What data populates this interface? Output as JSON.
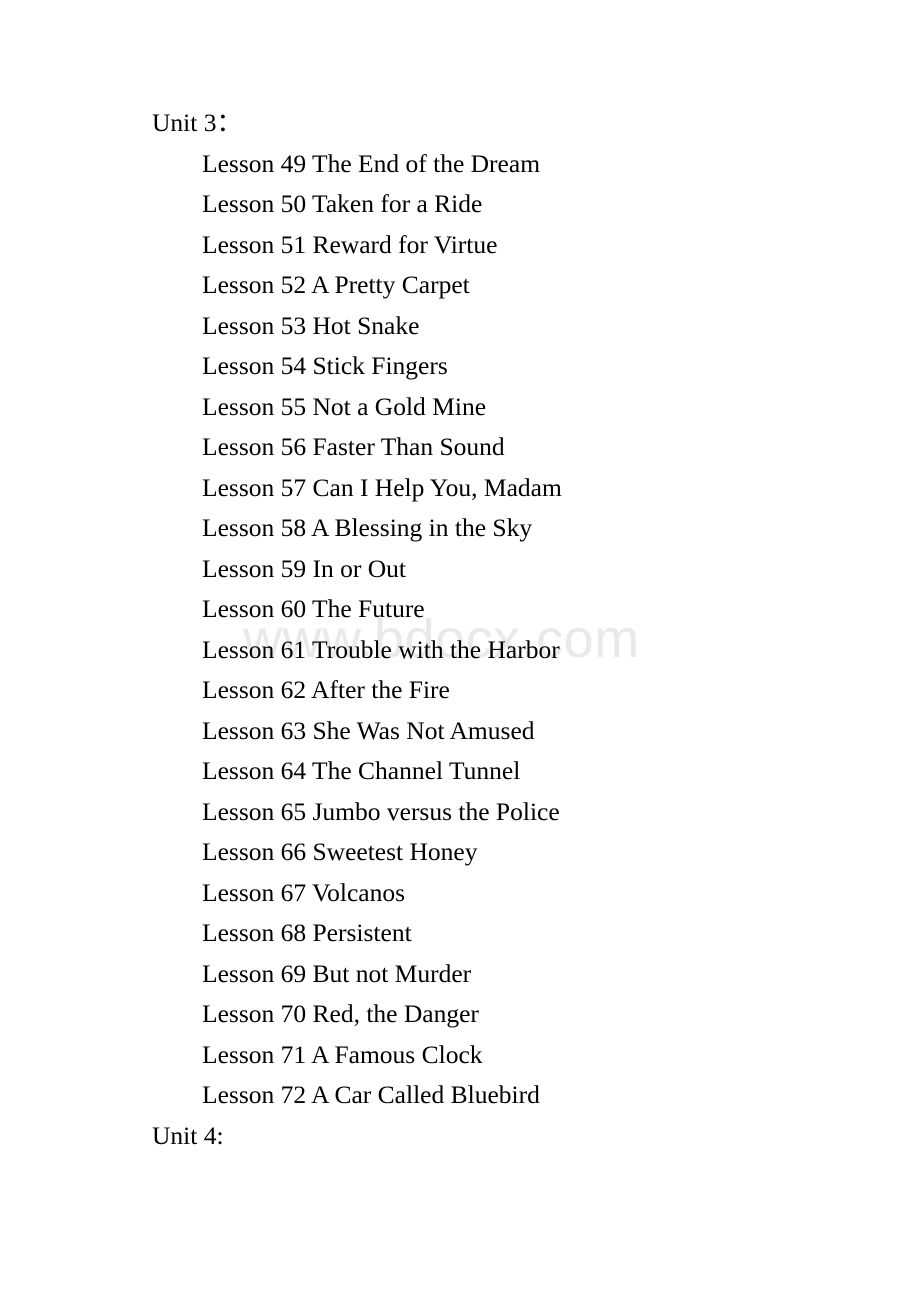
{
  "document": {
    "watermark": "www.bdocx.com",
    "watermark_color": "#e9e9e9",
    "text_color": "#000000",
    "background_color": "#ffffff",
    "unit_heading_top": "Unit 3：",
    "unit_heading_bottom": "Unit 4:",
    "lessons": [
      {
        "label": "Lesson 49 The End of the Dream"
      },
      {
        "label": "Lesson 50 Taken for a Ride"
      },
      {
        "label": "Lesson 51 Reward for Virtue"
      },
      {
        "label": "Lesson 52 A Pretty Carpet"
      },
      {
        "label": "Lesson 53 Hot Snake"
      },
      {
        "label": "Lesson 54 Stick Fingers"
      },
      {
        "label": "Lesson 55 Not a Gold Mine"
      },
      {
        "label": "Lesson 56 Faster Than Sound"
      },
      {
        "label": "Lesson 57 Can I Help You, Madam"
      },
      {
        "label": "Lesson 58 A Blessing in the Sky"
      },
      {
        "label": "Lesson 59 In or Out"
      },
      {
        "label": "Lesson 60 The Future"
      },
      {
        "label": "Lesson 61 Trouble with the Harbor"
      },
      {
        "label": "Lesson 62 After the Fire"
      },
      {
        "label": "Lesson 63 She Was Not Amused"
      },
      {
        "label": "Lesson 64 The Channel Tunnel"
      },
      {
        "label": "Lesson 65 Jumbo versus the Police"
      },
      {
        "label": "Lesson 66 Sweetest Honey"
      },
      {
        "label": "Lesson 67 Volcanos"
      },
      {
        "label": "Lesson 68 Persistent"
      },
      {
        "label": "Lesson 69 But not Murder"
      },
      {
        "label": "Lesson 70 Red, the Danger"
      },
      {
        "label": "Lesson 71 A Famous Clock"
      },
      {
        "label": "Lesson 72 A Car Called Bluebird"
      }
    ]
  }
}
